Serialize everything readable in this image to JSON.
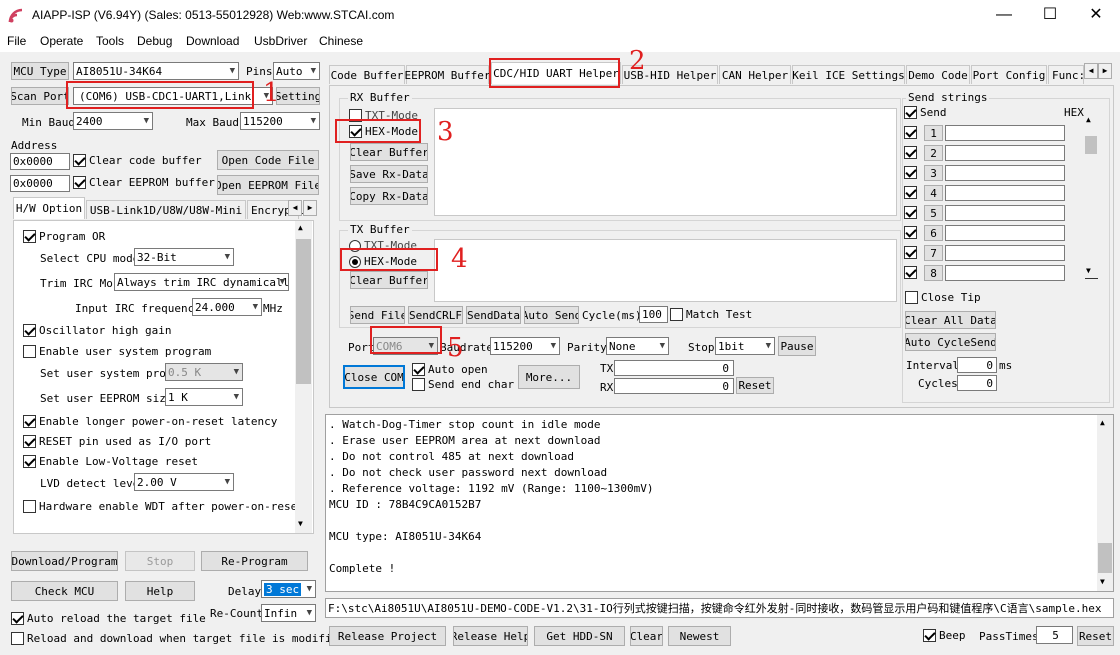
{
  "app": {
    "title": "AIAPP-ISP (V6.94Y) (Sales: 0513-55012928) Web:www.STCAI.com"
  },
  "menu": [
    "File",
    "Operate",
    "Tools",
    "Debug",
    "Download",
    "UsbDriver",
    "Chinese"
  ],
  "left": {
    "mcu_type_btn": "MCU Type",
    "mcu_type": "AI8051U-34K64",
    "pins_label": "Pins",
    "pins": "Auto",
    "scan_port_btn": "Scan Port",
    "port": "(COM6) USB-CDC1-UART1,Link",
    "setting_btn": "Setting",
    "min_baud_label": "Min Baud",
    "min_baud": "2400",
    "max_baud_label": "Max Baud",
    "max_baud": "115200",
    "address_label": "Address",
    "addr1": "0x0000",
    "addr2": "0x0000",
    "clear_code": "Clear code buffer",
    "clear_eeprom": "Clear EEPROM buffer",
    "open_code_btn": "Open Code File",
    "open_eeprom_btn": "Open EEPROM File",
    "tabs": [
      "H/W Option",
      "USB-Link1D/U8W/U8W-Mini",
      "Encrypti"
    ],
    "options": {
      "program_or": "Program OR",
      "cpu_mode_label": "Select CPU mode",
      "cpu_mode": "32-Bit",
      "trim_label": "Trim IRC Mo",
      "trim": "Always trim IRC dynamicall",
      "irc_label": "Input IRC frequency",
      "irc_value": "24.000",
      "irc_unit": "MHz",
      "osc": "Oscillator high gain",
      "user_prog": "Enable user system program",
      "set_prog_label": "Set user system prog",
      "set_prog": "0.5 K",
      "eeprom_label": "Set user EEPROM size",
      "eeprom": "1   K",
      "longer_por": "Enable longer power-on-reset latency",
      "reset_io": "RESET pin used as I/O port",
      "lvr": "Enable Low-Voltage reset",
      "lvd_label": "LVD detect leve",
      "lvd": "2.00 V",
      "wdt": "Hardware enable WDT after power-on-reset"
    },
    "download_btn": "Download/Program",
    "stop_btn": "Stop",
    "reprogram_btn": "Re-Program",
    "check_btn": "Check MCU",
    "help_btn": "Help",
    "delay_label": "Delay",
    "delay": "3 sec",
    "recount_label": "Re-Count",
    "recount": "Infin",
    "auto_reload": "Auto reload the target file",
    "reload_modified": "Reload and download when target file is modified"
  },
  "tabs": [
    "Code Buffer",
    "EEPROM Buffer",
    "CDC/HID UART Helper",
    "USB-HID Helper",
    "CAN Helper",
    "Keil ICE Settings",
    "Demo Code",
    "Port Config",
    "Func:"
  ],
  "uart": {
    "rx_title": "RX Buffer",
    "rx_txt": "TXT-Mode",
    "rx_hex": "HEX-Mode",
    "clear_buffer": "Clear Buffer",
    "save_rx": "Save Rx-Data",
    "copy_rx": "Copy Rx-Data",
    "tx_title": "TX Buffer",
    "tx_txt": "TXT-Mode",
    "tx_hex": "HEX-Mode",
    "tx_clear": "Clear Buffer",
    "send_file": "Send File",
    "send_crlf": "SendCRLF",
    "send_data": "SendData",
    "auto_send": "Auto Send",
    "cycle_label": "Cycle(ms)",
    "cycle": "100",
    "match_test": "Match Test",
    "port_label": "Port",
    "port": "COM6",
    "baud_label": "Baudrate",
    "baud": "115200",
    "parity_label": "Parity",
    "parity": "None",
    "stop_label": "Stop",
    "stop": "1bit",
    "pause": "Pause",
    "close_com": "Close COM",
    "auto_open": "Auto open",
    "send_end": "Send end char",
    "more": "More...",
    "tx_label": "TX",
    "tx_count": "0",
    "rx_label": "RX",
    "rx_count": "0",
    "reset": "Reset"
  },
  "send_strings": {
    "title": "Send strings",
    "send": "Send",
    "hex": "HEX",
    "rows": [
      "1",
      "2",
      "3",
      "4",
      "5",
      "6",
      "7",
      "8"
    ],
    "close_tip": "Close Tip",
    "clear_all": "Clear All Data",
    "auto_cycle": "Auto CycleSend",
    "interval_label": "Interval",
    "interval": "0",
    "interval_unit": "ms",
    "cycles_label": "Cycles",
    "cycles": "0"
  },
  "log": [
    ". Watch-Dog-Timer stop count in idle mode",
    ". Erase user EEPROM area at next download",
    ". Do not control 485 at next download",
    ". Do not check user password next download",
    ". Reference voltage: 1192 mV (Range: 1100~1300mV)",
    "MCU ID : 78B4C9CA0152B7",
    "",
    "MCU type: AI8051U-34K64",
    "",
    "Complete !"
  ],
  "path": "F:\\stc\\Ai8051U\\AI8051U-DEMO-CODE-V1.2\\31-IO行列式按键扫描，按键命令红外发射-同时接收，数码管显示用户码和键值程序\\C语言\\sample.hex",
  "bottom": {
    "release_project": "Release Project",
    "release_help": "Release Help",
    "get_hdd": "Get HDD-SN",
    "clear": "Clear",
    "newest": "Newest",
    "beep": "Beep",
    "pass_label": "PassTimes",
    "pass": "5",
    "reset": "Reset"
  },
  "annotations": [
    "1",
    "2",
    "3",
    "4",
    "5"
  ]
}
